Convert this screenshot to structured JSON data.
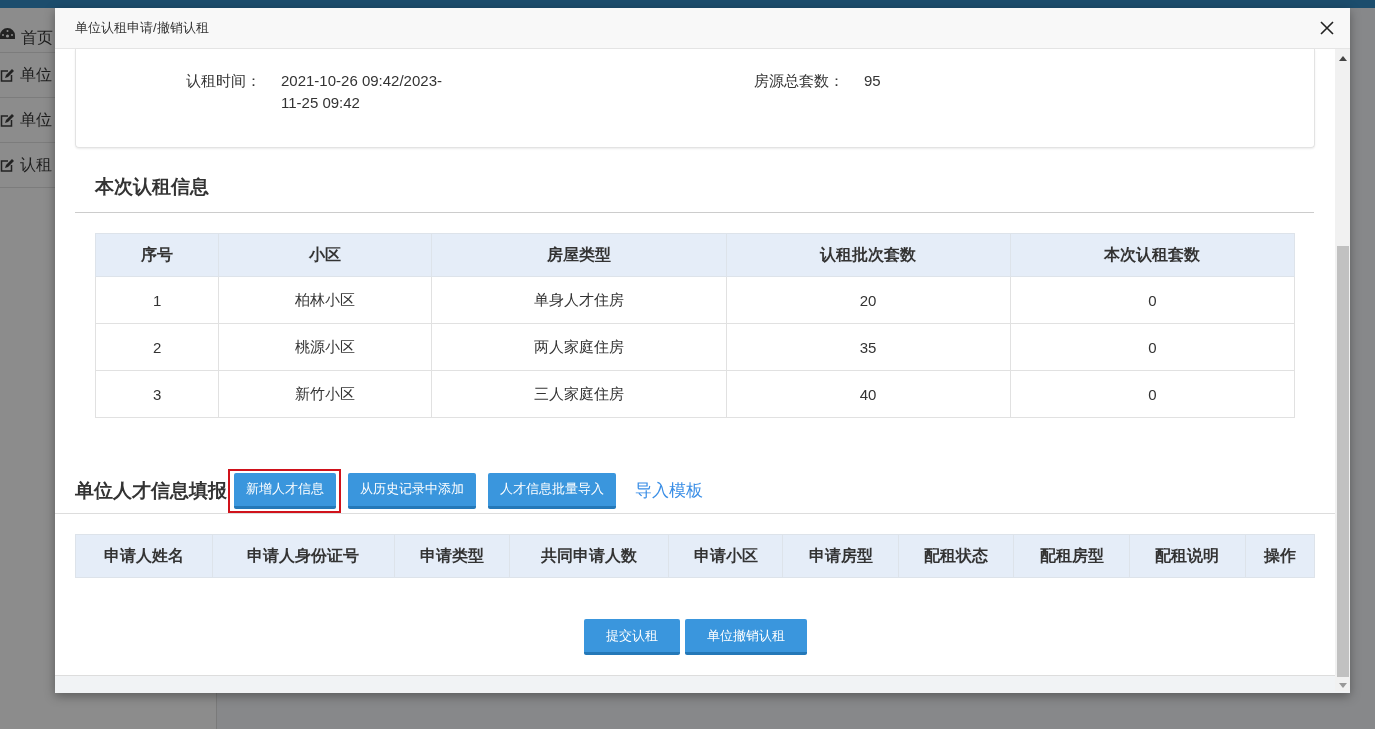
{
  "sidebar": {
    "items": [
      {
        "label": "首页",
        "kind": "dashboard"
      },
      {
        "label": "单位",
        "kind": "edit"
      },
      {
        "label": "单位",
        "kind": "edit"
      },
      {
        "label": "认租",
        "kind": "edit"
      }
    ]
  },
  "dialog": {
    "title": "单位认租申请/撤销认租",
    "summary": [
      {
        "label": "认租时间：",
        "value": "2021-10-26 09:42/2023-11-25 09:42"
      },
      {
        "label": "房源总套数：",
        "value": "95"
      }
    ],
    "rent_section": {
      "title": "本次认租信息",
      "table": {
        "columns": [
          "序号",
          "小区",
          "房屋类型",
          "认租批次套数",
          "本次认租套数"
        ],
        "rows": [
          [
            "1",
            "柏林小区",
            "单身人才住房",
            "20",
            "0"
          ],
          [
            "2",
            "桃源小区",
            "两人家庭住房",
            "35",
            "0"
          ],
          [
            "3",
            "新竹小区",
            "三人家庭住房",
            "40",
            "0"
          ]
        ]
      }
    },
    "talent_section": {
      "title": "单位人才信息填报",
      "actions": [
        {
          "label": "新增人才信息",
          "kind": "button",
          "highlighted": true
        },
        {
          "label": "从历史记录中添加",
          "kind": "button",
          "highlighted": false
        },
        {
          "label": "人才信息批量导入",
          "kind": "button",
          "highlighted": false
        },
        {
          "label": "导入模板",
          "kind": "link",
          "highlighted": false
        }
      ],
      "table": {
        "columns": [
          "申请人姓名",
          "申请人身份证号",
          "申请类型",
          "共同申请人数",
          "申请小区",
          "申请房型",
          "配租状态",
          "配租房型",
          "配租说明",
          "操作"
        ]
      }
    },
    "buttons": [
      "提交认租",
      "单位撤销认租"
    ]
  }
}
